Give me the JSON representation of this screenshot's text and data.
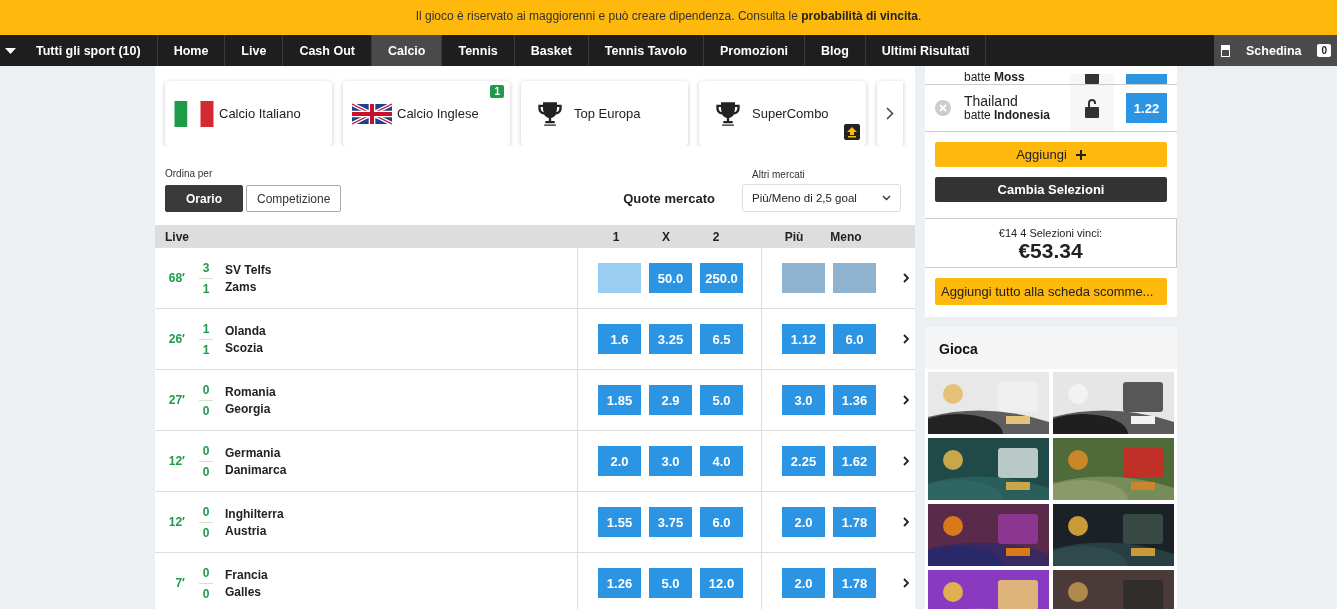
{
  "banner": {
    "text": "Il gioco è riservato ai maggiorenni e può creare dipendenza. Consulta le **probabilità di vincita**."
  },
  "nav": {
    "items": [
      {
        "label": "Tutti gli sport (10)",
        "selected": false
      },
      {
        "label": "Home",
        "selected": false
      },
      {
        "label": "Live",
        "selected": false
      },
      {
        "label": "Cash Out",
        "selected": false
      },
      {
        "label": "Calcio",
        "selected": true
      },
      {
        "label": "Tennis",
        "selected": false
      },
      {
        "label": "Basket",
        "selected": false
      },
      {
        "label": "Tennis Tavolo",
        "selected": false
      },
      {
        "label": "Promozioni",
        "selected": false
      },
      {
        "label": "Blog",
        "selected": false
      },
      {
        "label": "Ultimi Risultati",
        "selected": false
      }
    ],
    "betslip": {
      "label": "Schedina",
      "count": "0"
    }
  },
  "categories": [
    {
      "kind": "italy",
      "label": "Calcio Italiano"
    },
    {
      "kind": "uk",
      "label": "Calcio Inglese",
      "badge": "1"
    },
    {
      "kind": "trophy",
      "label": "Top Europa"
    },
    {
      "kind": "trophy",
      "label": "SuperCombo",
      "boost": true
    }
  ],
  "sort": {
    "label": "Ordina per",
    "options": [
      {
        "label": "Orario",
        "selected": true
      },
      {
        "label": "Competizione",
        "selected": false
      }
    ]
  },
  "market": {
    "title": "Quote mercato",
    "label": "Altri mercati",
    "value": "Più/Meno di 2,5 goal"
  },
  "events": {
    "columns": [
      "Live",
      "1",
      "X",
      "2",
      "Più",
      "Meno"
    ],
    "rows": [
      {
        "minute": "68′",
        "score": [
          "3",
          "1"
        ],
        "teams": [
          "SV Telfs",
          "Zams"
        ],
        "odds": [
          {
            "suspended": true
          },
          {
            "suspended": false,
            "value": "50.0"
          },
          {
            "suspended": false,
            "value": "250.0"
          },
          {
            "suspended": true
          },
          {
            "suspended": true
          }
        ]
      },
      {
        "minute": "26′",
        "score": [
          "1",
          "1"
        ],
        "teams": [
          "Olanda",
          "Scozia"
        ],
        "odds": [
          {
            "suspended": false,
            "value": "1.6"
          },
          {
            "suspended": false,
            "value": "3.25"
          },
          {
            "suspended": false,
            "value": "6.5"
          },
          {
            "suspended": false,
            "value": "1.12"
          },
          {
            "suspended": false,
            "value": "6.0"
          }
        ]
      },
      {
        "minute": "27′",
        "score": [
          "0",
          "0"
        ],
        "teams": [
          "Romania",
          "Georgia"
        ],
        "odds": [
          {
            "suspended": false,
            "value": "1.85"
          },
          {
            "suspended": false,
            "value": "2.9"
          },
          {
            "suspended": false,
            "value": "5.0"
          },
          {
            "suspended": false,
            "value": "3.0"
          },
          {
            "suspended": false,
            "value": "1.36"
          }
        ]
      },
      {
        "minute": "12′",
        "score": [
          "0",
          "0"
        ],
        "teams": [
          "Germania",
          "Danimarca"
        ],
        "odds": [
          {
            "suspended": false,
            "value": "2.0"
          },
          {
            "suspended": false,
            "value": "3.0"
          },
          {
            "suspended": false,
            "value": "4.0"
          },
          {
            "suspended": false,
            "value": "2.25"
          },
          {
            "suspended": false,
            "value": "1.62"
          }
        ]
      },
      {
        "minute": "12′",
        "score": [
          "0",
          "0"
        ],
        "teams": [
          "Inghilterra",
          "Austria"
        ],
        "odds": [
          {
            "suspended": false,
            "value": "1.55"
          },
          {
            "suspended": false,
            "value": "3.75"
          },
          {
            "suspended": false,
            "value": "6.0"
          },
          {
            "suspended": false,
            "value": "2.0"
          },
          {
            "suspended": false,
            "value": "1.78"
          }
        ]
      },
      {
        "minute": "7′",
        "score": [
          "0",
          "0"
        ],
        "teams": [
          "Francia",
          "Galles"
        ],
        "odds": [
          {
            "suspended": false,
            "value": "1.26"
          },
          {
            "suspended": false,
            "value": "5.0"
          },
          {
            "suspended": false,
            "value": "12.0"
          },
          {
            "suspended": false,
            "value": "2.0"
          },
          {
            "suspended": false,
            "value": "1.78"
          }
        ]
      }
    ]
  },
  "slip": {
    "selections": [
      {
        "clipped": true,
        "detail": "batte **Moss**"
      },
      {
        "clipped": false,
        "team": "Thailand",
        "detail": "batte **Indonesia**",
        "odds": "1.22"
      }
    ],
    "add_button": "Aggiungi",
    "change_button": "Cambia Selezioni",
    "summary": "€14 4 Selezioni vinci:",
    "payout": "€53.34",
    "add_all_button": "Aggiungi tutto alla scheda scomme..."
  },
  "games": {
    "title": "Gioca"
  }
}
